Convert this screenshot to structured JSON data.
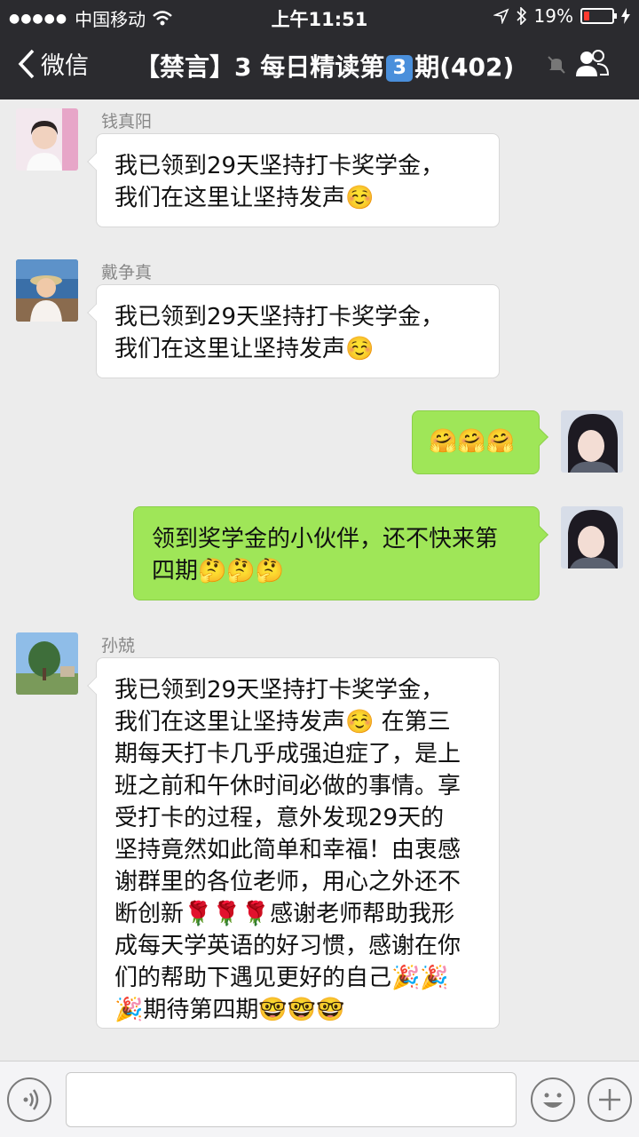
{
  "status_bar": {
    "carrier": "中国移动",
    "time": "上午11:51",
    "battery": "19%",
    "battery_level": 0.19
  },
  "header": {
    "back_label": "微信",
    "title_prefix": "【禁言】3 每日精读第",
    "issue_number": "3",
    "title_suffix": "期(402)"
  },
  "messages": [
    {
      "sender": "钱真阳",
      "lines": [
        "我已领到29天坚持打卡奖学金，",
        "我们在这里让坚持发声☺️"
      ]
    },
    {
      "sender": "戴争真",
      "lines": [
        "我已领到29天坚持打卡奖学金，",
        "我们在这里让坚持发声☺️"
      ]
    },
    {
      "lines": [
        "🤗🤗🤗"
      ]
    },
    {
      "lines": [
        "领到奖学金的小伙伴，还不快来第",
        "四期🤔🤔🤔"
      ]
    },
    {
      "sender": "孙兢",
      "lines": [
        "我已领到29天坚持打卡奖学金，",
        "我们在这里让坚持发声☺️  在第三",
        "期每天打卡几乎成强迫症了，是上",
        "班之前和午休时间必做的事情。享",
        "受打卡的过程，意外发现29天的",
        "坚持竟然如此简单和幸福！由衷感",
        "谢群里的各位老师，用心之外还不",
        "断创新🌹🌹🌹感谢老师帮助我形",
        "成每天学英语的好习惯，感谢在你",
        "们的帮助下遇见更好的自己🎉🎉",
        "🎉期待第四期🤓🤓🤓"
      ]
    }
  ]
}
